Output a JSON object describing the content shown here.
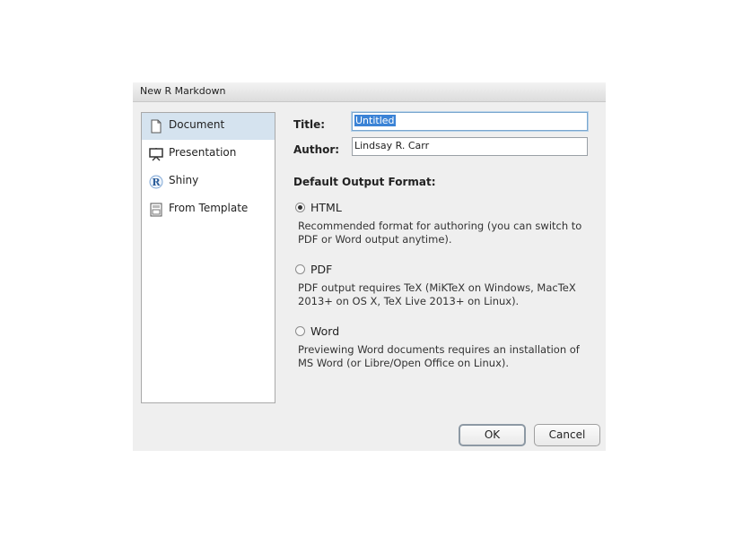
{
  "dialog": {
    "title": "New R Markdown"
  },
  "sidebar": {
    "items": [
      {
        "label": "Document",
        "icon": "document-icon",
        "selected": true
      },
      {
        "label": "Presentation",
        "icon": "presentation-icon",
        "selected": false
      },
      {
        "label": "Shiny",
        "icon": "shiny-r-icon",
        "selected": false
      },
      {
        "label": "From Template",
        "icon": "template-icon",
        "selected": false
      }
    ]
  },
  "form": {
    "title_label": "Title:",
    "title_value": "Untitled",
    "author_label": "Author:",
    "author_value": "Lindsay R. Carr",
    "output_heading": "Default Output Format:"
  },
  "formats": [
    {
      "label": "HTML",
      "selected": true,
      "description": "Recommended format for authoring (you can switch to PDF or Word output anytime)."
    },
    {
      "label": "PDF",
      "selected": false,
      "description": "PDF output requires TeX (MiKTeX on Windows, MacTeX 2013+ on OS X, TeX Live 2013+ on Linux)."
    },
    {
      "label": "Word",
      "selected": false,
      "description": "Previewing Word documents requires an installation of MS Word (or Libre/Open Office on Linux)."
    }
  ],
  "buttons": {
    "ok": "OK",
    "cancel": "Cancel"
  },
  "colors": {
    "selection_bg": "#d5e3ef",
    "text_highlight": "#3b83d6"
  }
}
